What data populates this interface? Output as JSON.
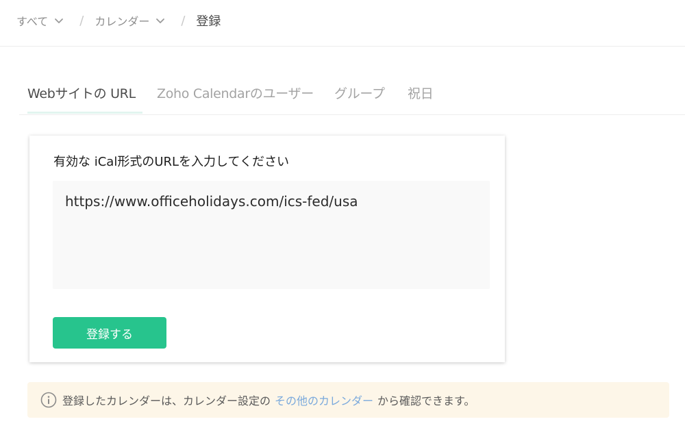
{
  "breadcrumb": {
    "items": [
      {
        "label": "すべて",
        "icon": "chevron-down-icon"
      },
      {
        "label": "カレンダー",
        "icon": "chevron-down-icon"
      }
    ],
    "separator": "/",
    "current": "登録"
  },
  "tabs": [
    {
      "label": "Webサイトの URL",
      "active": true
    },
    {
      "label": "Zoho Calendarのユーザー",
      "active": false
    },
    {
      "label": "グループ",
      "active": false
    },
    {
      "label": "祝日",
      "active": false
    }
  ],
  "form": {
    "label": "有効な iCal形式のURLを入力してください",
    "url_value": "https://www.officeholidays.com/ics-fed/usa",
    "submit_label": "登録する"
  },
  "info": {
    "icon": "info-icon",
    "text_before": "登録したカレンダーは、カレンダー設定の",
    "link_text": "その他のカレンダー",
    "text_after": "から確認できます。"
  },
  "colors": {
    "accent": "#27c48d",
    "link": "#7aa9dc",
    "info_bg": "#fdf6e8"
  }
}
